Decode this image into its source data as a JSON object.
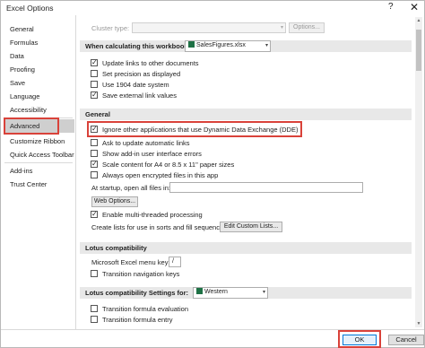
{
  "window": {
    "title": "Excel Options",
    "help_glyph": "?",
    "close_glyph": "✕"
  },
  "sidebar": {
    "items": [
      {
        "label": "General"
      },
      {
        "label": "Formulas"
      },
      {
        "label": "Data"
      },
      {
        "label": "Proofing"
      },
      {
        "label": "Save"
      },
      {
        "label": "Language"
      },
      {
        "label": "Accessibility"
      },
      {
        "label": "Advanced",
        "selected": true
      },
      {
        "label": "Customize Ribbon"
      },
      {
        "label": "Quick Access Toolbar"
      },
      {
        "label": "Add-ins"
      },
      {
        "label": "Trust Center"
      }
    ]
  },
  "content": {
    "cluster_type_label": "Cluster type:",
    "options_button": "Options...",
    "calc_section_label": "When calculating this workbook:",
    "workbook_name": "SalesFigures.xlsx",
    "calc_options": [
      {
        "label": "Update links to other documents",
        "checked": true
      },
      {
        "label": "Set precision as displayed",
        "checked": false
      },
      {
        "label": "Use 1904 date system",
        "checked": false
      },
      {
        "label": "Save external link values",
        "checked": true
      }
    ],
    "general_header": "General",
    "general_options": [
      {
        "label": "Ignore other applications that use Dynamic Data Exchange (DDE)",
        "checked": true
      },
      {
        "label": "Ask to update automatic links",
        "checked": false
      },
      {
        "label": "Show add-in user interface errors",
        "checked": false
      },
      {
        "label": "Scale content for A4 or 8.5 x 11\" paper sizes",
        "checked": true
      },
      {
        "label": "Always open encrypted files in this app",
        "checked": false
      }
    ],
    "startup_label": "At startup, open all files in:",
    "startup_value": "",
    "web_options_button": "Web Options...",
    "multithread_label": "Enable multi-threaded processing",
    "multithread_checked": true,
    "custom_lists_label": "Create lists for use in sorts and fill sequences:",
    "edit_custom_lists_button": "Edit Custom Lists...",
    "lotus_header": "Lotus compatibility",
    "menu_key_label": "Microsoft Excel menu key:",
    "menu_key_value": "/",
    "transition_nav_label": "Transition navigation keys",
    "transition_nav_checked": false,
    "lotus_settings_header": "Lotus compatibility Settings for:",
    "lotus_settings_sheet": "Western",
    "lotus_settings_options": [
      {
        "label": "Transition formula evaluation",
        "checked": false
      },
      {
        "label": "Transition formula entry",
        "checked": false
      }
    ]
  },
  "footer": {
    "ok": "OK",
    "cancel": "Cancel"
  },
  "colors": {
    "highlight_box": "#d9423a",
    "section_header": "#e8e8e8",
    "selected_nav": "#cfcfcf"
  }
}
